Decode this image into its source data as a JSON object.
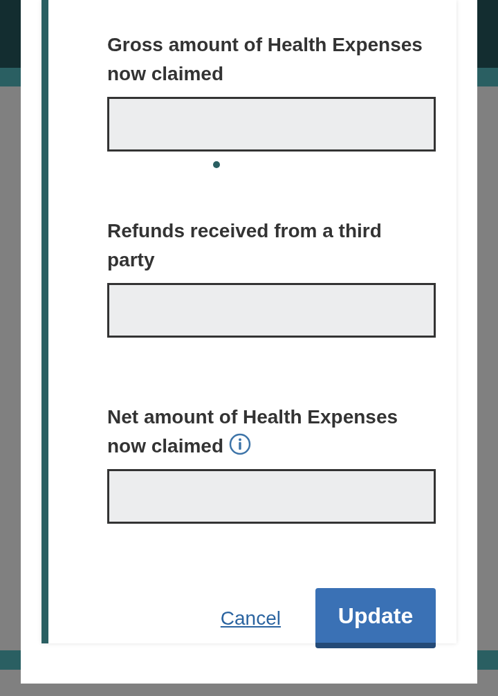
{
  "fields": [
    {
      "label": "Gross amount of Health Expenses now claimed",
      "info": false
    },
    {
      "label": "Refunds received from a third party",
      "info": false
    },
    {
      "label": "Net amount of Health Expenses now claimed",
      "info": true
    }
  ],
  "actions": {
    "cancel": "Cancel",
    "submit": "Update"
  }
}
